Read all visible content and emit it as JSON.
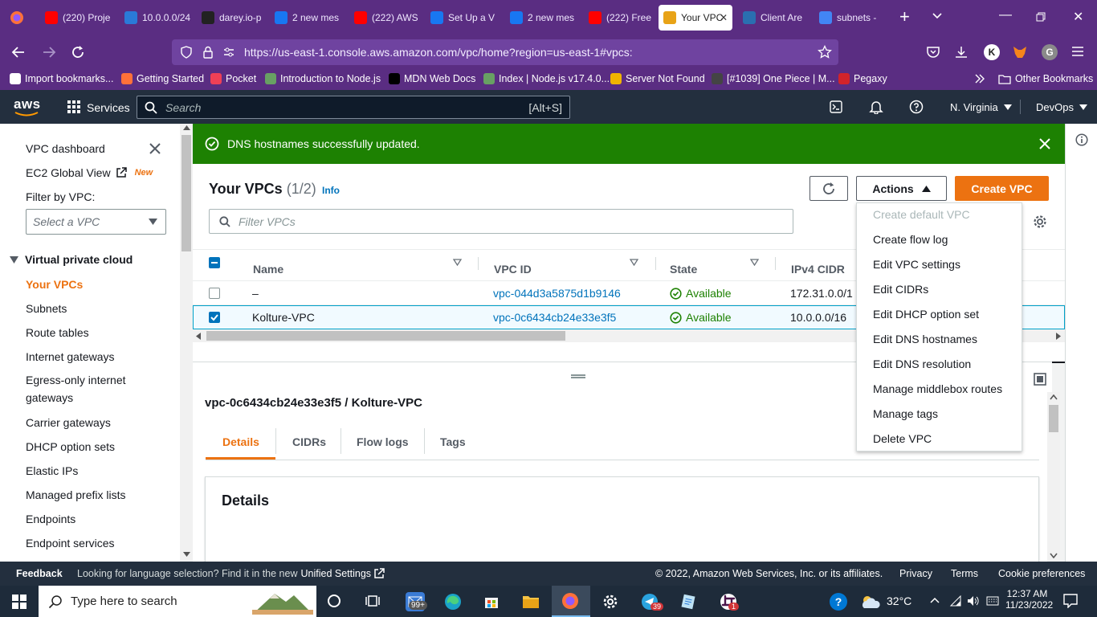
{
  "browser": {
    "tabs": [
      {
        "label": "(220) Proje",
        "icon": "youtube-icon",
        "color": "#ff0000"
      },
      {
        "label": "10.0.0.0/24",
        "icon": "subnet-calculator-icon",
        "color": "#2a7ad8"
      },
      {
        "label": "darey.io-p",
        "icon": "github-icon",
        "color": "#222222"
      },
      {
        "label": "2 new mes",
        "icon": "messenger-icon",
        "color": "#1877f2"
      },
      {
        "label": "(222) AWS",
        "icon": "youtube-icon",
        "color": "#ff0000"
      },
      {
        "label": "Set Up a V",
        "icon": "messenger-icon",
        "color": "#1877f2"
      },
      {
        "label": "2 new mes",
        "icon": "messenger-icon",
        "color": "#1877f2"
      },
      {
        "label": "(222) Free",
        "icon": "youtube-icon",
        "color": "#ff0000"
      },
      {
        "label": "Your VPC",
        "icon": "aws-vpc-icon",
        "color": "#e8a317",
        "active": true
      },
      {
        "label": "Client Are",
        "icon": "client-area-icon",
        "color": "#2a6fb0"
      },
      {
        "label": "subnets -",
        "icon": "google-icon",
        "color": "#4285f4"
      }
    ],
    "url": "https://us-east-1.console.aws.amazon.com/vpc/home?region=us-east-1#vpcs:",
    "url_host": "aws.amazon.com",
    "account_initial": "K",
    "bookmarks": [
      {
        "label": "Import bookmarks...",
        "icon": "import-icon",
        "color": "#ffffff"
      },
      {
        "label": "Getting Started",
        "icon": "firefox-icon",
        "color": "#ff7139"
      },
      {
        "label": "Pocket",
        "icon": "pocket-icon",
        "color": "#ef4056"
      },
      {
        "label": "Introduction to Node.js",
        "icon": "nodejs-icon",
        "color": "#68a063"
      },
      {
        "label": "MDN Web Docs",
        "icon": "mdn-icon",
        "color": "#000000"
      },
      {
        "label": "Index | Node.js v17.4.0...",
        "icon": "nodejs-icon",
        "color": "#68a063"
      },
      {
        "label": "Server Not Found",
        "icon": "warning-icon",
        "color": "#f0b400"
      },
      {
        "label": "[#1039] One Piece | M...",
        "icon": "globe-icon",
        "color": "#444444"
      },
      {
        "label": "Pegaxy",
        "icon": "pegaxy-icon",
        "color": "#d2232a"
      }
    ],
    "other_bookmarks": "Other Bookmarks"
  },
  "aws_header": {
    "logo": "aws",
    "services": "Services",
    "search_placeholder": "Search",
    "search_shortcut": "[Alt+S]",
    "region": "N. Virginia",
    "account": "DevOps"
  },
  "sidebar": {
    "top_items": [
      {
        "label": "VPC dashboard"
      },
      {
        "label": "EC2 Global View",
        "badge": "New"
      }
    ],
    "filter_label": "Filter by VPC:",
    "filter_placeholder": "Select a VPC",
    "section": "Virtual private cloud",
    "items": [
      {
        "label": "Your VPCs",
        "active": true
      },
      {
        "label": "Subnets"
      },
      {
        "label": "Route tables"
      },
      {
        "label": "Internet gateways"
      },
      {
        "label": "Egress-only internet gateways"
      },
      {
        "label": "Carrier gateways"
      },
      {
        "label": "DHCP option sets"
      },
      {
        "label": "Elastic IPs"
      },
      {
        "label": "Managed prefix lists"
      },
      {
        "label": "Endpoints"
      },
      {
        "label": "Endpoint services"
      }
    ]
  },
  "flash": {
    "message": "DNS hostnames successfully updated."
  },
  "vpcs_panel": {
    "title": "Your VPCs",
    "count": "(1/2)",
    "info": "Info",
    "actions_label": "Actions",
    "create_label": "Create VPC",
    "filter_placeholder": "Filter VPCs",
    "columns": [
      "Name",
      "VPC ID",
      "State",
      "IPv4 CIDR"
    ],
    "rows": [
      {
        "name": "–",
        "vpc_id": "vpc-044d3a5875d1b9146",
        "state": "Available",
        "cidr": "172.31.0.0/1",
        "checked": false
      },
      {
        "name": "Kolture-VPC",
        "vpc_id": "vpc-0c6434cb24e33e3f5",
        "state": "Available",
        "cidr": "10.0.0.0/16",
        "checked": true
      }
    ]
  },
  "actions_menu": {
    "items": [
      {
        "label": "Create default VPC",
        "disabled": true
      },
      {
        "label": "Create flow log"
      },
      {
        "label": "Edit VPC settings"
      },
      {
        "label": "Edit CIDRs"
      },
      {
        "label": "Edit DHCP option set"
      },
      {
        "label": "Edit DNS hostnames"
      },
      {
        "label": "Edit DNS resolution"
      },
      {
        "label": "Manage middlebox routes"
      },
      {
        "label": "Manage tags"
      },
      {
        "label": "Delete VPC"
      }
    ]
  },
  "detail": {
    "title": "vpc-0c6434cb24e33e3f5 / Kolture-VPC",
    "tabs": [
      "Details",
      "CIDRs",
      "Flow logs",
      "Tags"
    ],
    "active_tab": "Details",
    "section_title": "Details"
  },
  "footer": {
    "feedback": "Feedback",
    "language_prompt": "Looking for language selection? Find it in the new",
    "unified_settings": "Unified Settings",
    "copyright": "© 2022, Amazon Web Services, Inc. or its affiliates.",
    "links": [
      "Privacy",
      "Terms",
      "Cookie preferences"
    ]
  },
  "taskbar": {
    "search_placeholder": "Type here to search",
    "mail_badge": "99+",
    "telegram_badge": "39",
    "slack_badge": "1",
    "weather": "32°C",
    "time": "12:37 AM",
    "date": "11/23/2022"
  },
  "colors": {
    "browser_chrome": "#5a2d82",
    "aws_header": "#232f3e",
    "success": "#1d8102",
    "primary_button": "#ec7211",
    "link": "#0073bb",
    "active_nav": "#ec7211"
  }
}
